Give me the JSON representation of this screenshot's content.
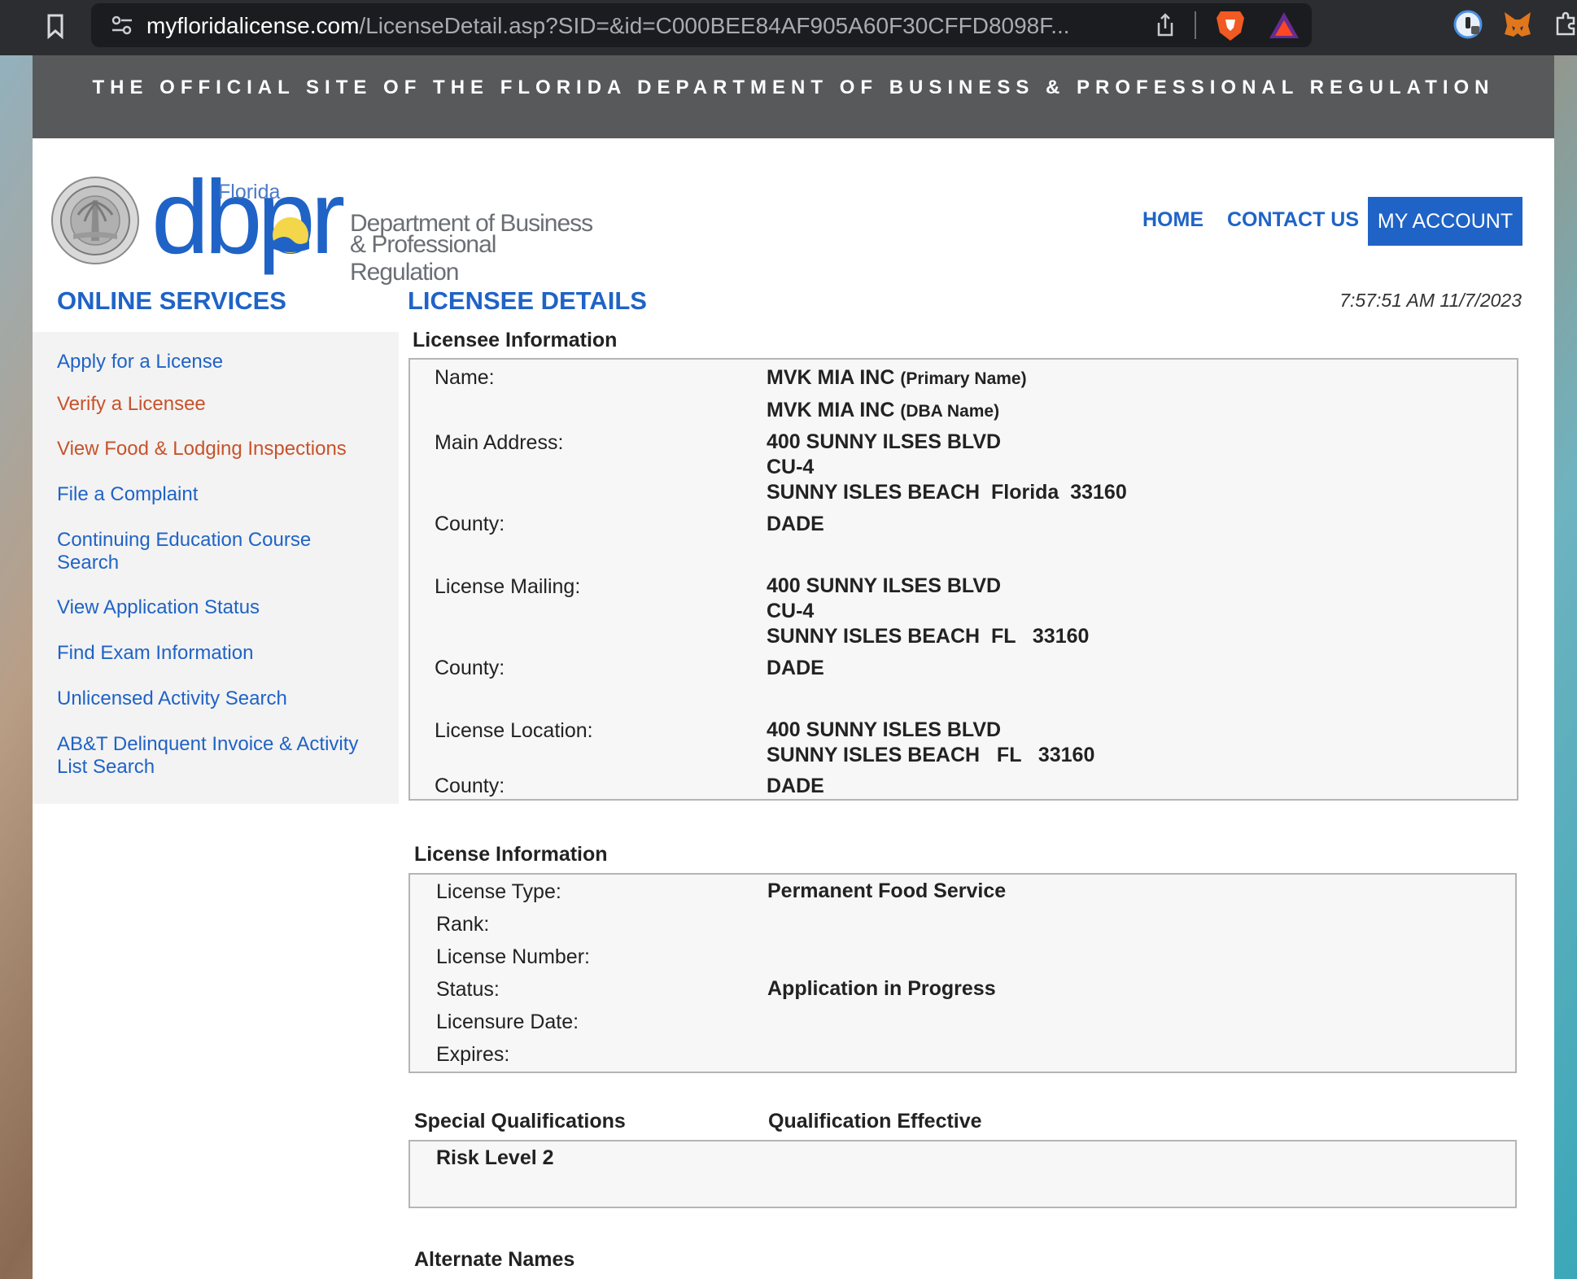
{
  "browser": {
    "url_host": "myfloridalicense.com",
    "url_path": "/LicenseDetail.asp?SID=&id=C000BEE84AF905A60F30CFFD8098F..."
  },
  "site": {
    "banner": "THE OFFICIAL SITE OF THE FLORIDA DEPARTMENT OF BUSINESS & PROFESSIONAL REGULATION",
    "logo_florida": "Florida",
    "logo_dbpr": "dbpr",
    "logo_dept_line1": "Department of Business",
    "logo_dept_line2": "& Professional Regulation",
    "nav": {
      "home": "HOME",
      "contact": "CONTACT US",
      "account": "MY ACCOUNT"
    }
  },
  "sidebar": {
    "title": "ONLINE SERVICES",
    "items": [
      {
        "label": "Apply for a License"
      },
      {
        "label": "Verify a Licensee"
      },
      {
        "label": "View Food & Lodging Inspections"
      },
      {
        "label": "File a Complaint"
      },
      {
        "label": "Continuing Education Course Search"
      },
      {
        "label": "View Application Status"
      },
      {
        "label": "Find Exam Information"
      },
      {
        "label": "Unlicensed Activity Search"
      },
      {
        "label": "AB&T Delinquent Invoice & Activity List Search"
      }
    ]
  },
  "main": {
    "title": "LICENSEE DETAILS",
    "timestamp": "7:57:51 AM 11/7/2023",
    "licensee": {
      "section_title": "Licensee Information",
      "name_label": "Name:",
      "primary_name": "MVK MIA INC",
      "primary_tag": "(Primary Name)",
      "dba_name": "MVK MIA INC",
      "dba_tag": "(DBA Name)",
      "main_address_label": "Main Address:",
      "main_address": "400 SUNNY ILSES BLVD\nCU-4\nSUNNY ISLES BEACH  Florida  33160",
      "county_label": "County:",
      "main_county": "DADE",
      "mailing_label": "License Mailing:",
      "mailing_address": "400 SUNNY ILSES BLVD\nCU-4\nSUNNY ISLES BEACH  FL   33160",
      "mailing_county": "DADE",
      "location_label": "License Location:",
      "location_address": "400 SUNNY ISLES BLVD\nSUNNY ISLES BEACH   FL   33160",
      "location_county": "DADE"
    },
    "license": {
      "section_title": "License Information",
      "type_label": "License Type:",
      "type_value": "Permanent Food Service",
      "rank_label": "Rank:",
      "number_label": "License Number:",
      "status_label": "Status:",
      "status_value": "Application in Progress",
      "licensure_label": "Licensure Date:",
      "expires_label": "Expires:"
    },
    "qualifications": {
      "col1": "Special Qualifications",
      "col2": "Qualification Effective",
      "rows": [
        {
          "name": "Risk Level 2"
        }
      ]
    },
    "alternate_names": {
      "section_title": "Alternate Names"
    }
  }
}
